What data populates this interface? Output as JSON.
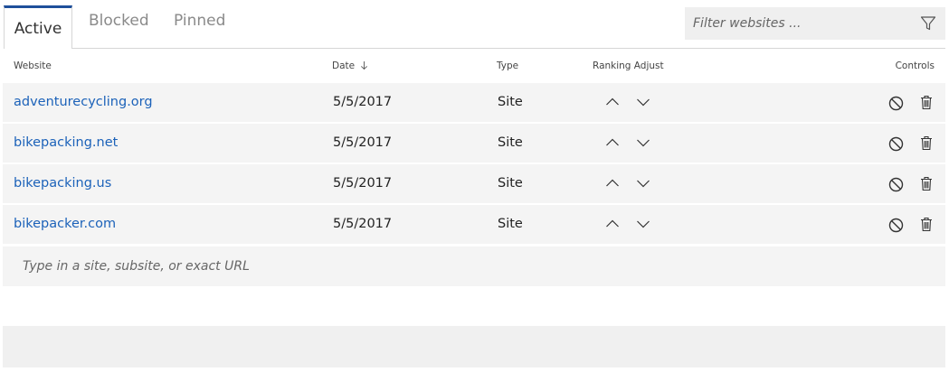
{
  "tabs": [
    {
      "label": "Active",
      "active": true
    },
    {
      "label": "Blocked",
      "active": false
    },
    {
      "label": "Pinned",
      "active": false
    }
  ],
  "filter": {
    "placeholder": "Filter websites ...",
    "icon": "filter-funnel-icon"
  },
  "columns": {
    "website": "Website",
    "date": "Date",
    "type": "Type",
    "ranking": "Ranking Adjust",
    "controls": "Controls"
  },
  "rows": [
    {
      "site": "adventurecycling.org",
      "date": "5/5/2017",
      "type": "Site"
    },
    {
      "site": "bikepacking.net",
      "date": "5/5/2017",
      "type": "Site"
    },
    {
      "site": "bikepacking.us",
      "date": "5/5/2017",
      "type": "Site"
    },
    {
      "site": "bikepacker.com",
      "date": "5/5/2017",
      "type": "Site"
    }
  ],
  "add_row": {
    "placeholder": "Type in a site, subsite, or exact URL"
  },
  "colors": {
    "accent": "#1f4f9a",
    "link": "#1c62b9",
    "row_bg": "#f4f4f4"
  }
}
